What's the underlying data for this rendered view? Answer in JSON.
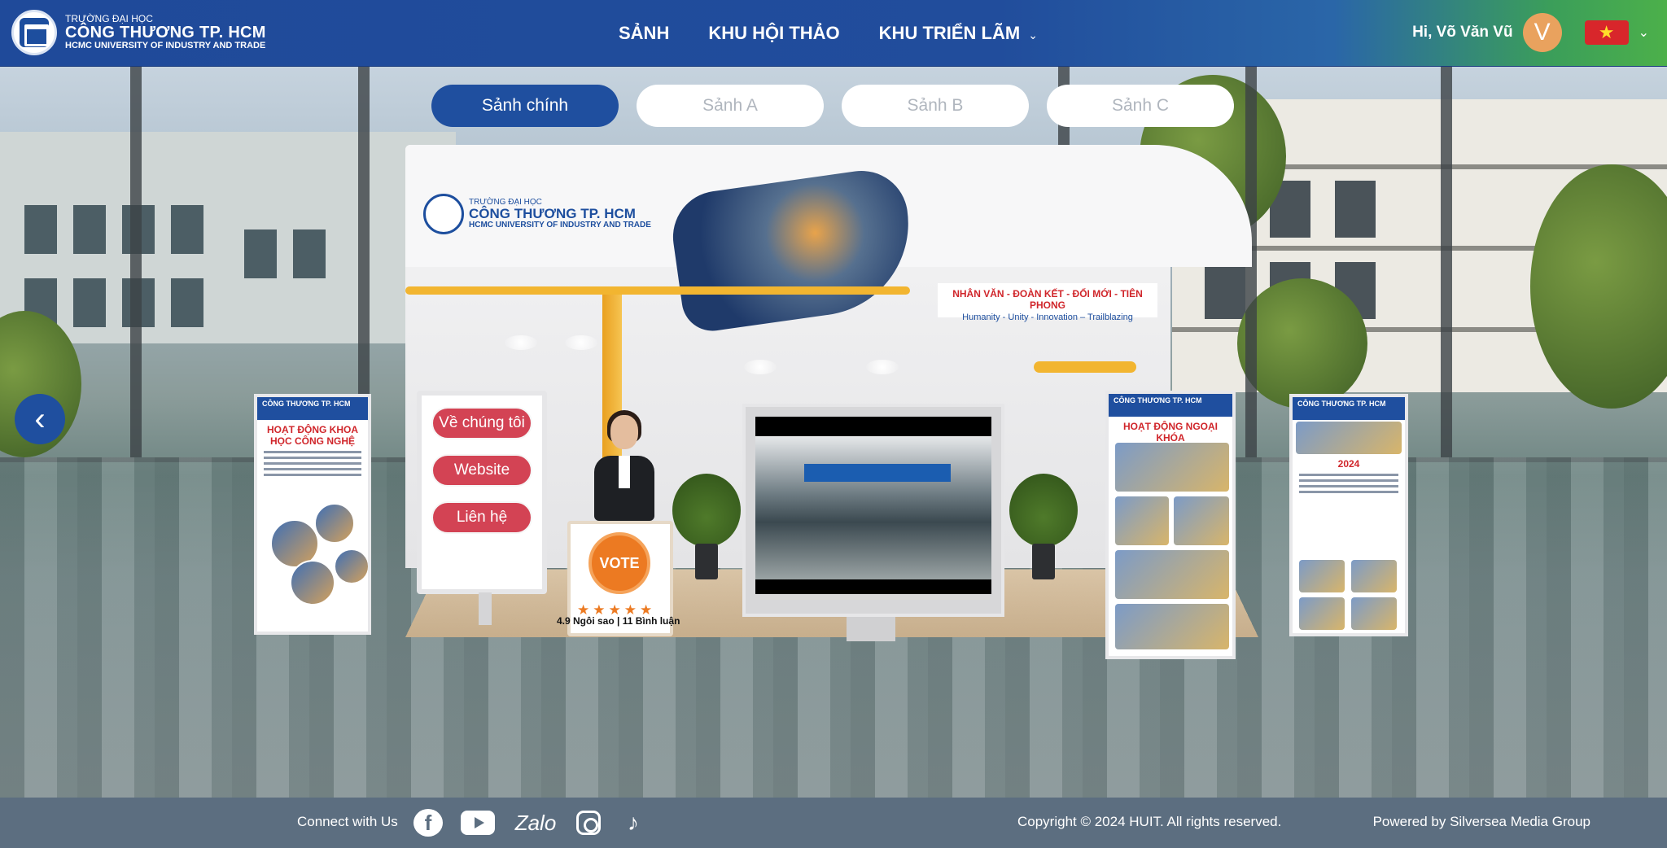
{
  "header": {
    "logo": {
      "line1": "TRƯỜNG ĐẠI HỌC",
      "line2": "CÔNG THƯƠNG TP. HCM",
      "line3": "HCMC UNIVERSITY OF INDUSTRY AND TRADE"
    },
    "nav": [
      {
        "label": "SẢNH"
      },
      {
        "label": "KHU HỘI THẢO"
      },
      {
        "label": "KHU TRIỂN LÃM",
        "has_dropdown": true
      }
    ],
    "user": {
      "greeting": "Hi, Võ Văn Vũ",
      "avatar_initial": "V",
      "avatar_color": "#e9a25e",
      "language_flag": "vietnam-flag-icon"
    }
  },
  "tabs": [
    {
      "label": "Sảnh chính",
      "active": true
    },
    {
      "label": "Sảnh A",
      "active": false
    },
    {
      "label": "Sảnh B",
      "active": false
    },
    {
      "label": "Sảnh C",
      "active": false
    }
  ],
  "booth": {
    "logo": {
      "line1": "TRƯỜNG ĐẠI HỌC",
      "line2": "CÔNG THƯƠNG TP. HCM",
      "line3": "HCMC UNIVERSITY OF INDUSTRY AND TRADE"
    },
    "slogan_vi": "NHÂN VĂN - ĐOÀN KẾT - ĐỔI MỚI - TIÊN PHONG",
    "slogan_en": "Humanity - Unity - Innovation – Trailblazing",
    "menu": [
      {
        "label": "Về chúng tôi"
      },
      {
        "label": "Website"
      },
      {
        "label": "Liên hệ"
      }
    ],
    "vote": {
      "badge": "VOTE",
      "stars": 5,
      "rating_text": "4.9 Ngôi sao | 11 Bình luận"
    },
    "poster_left": {
      "title": "HOẠT ĐỘNG KHOA HỌC CÔNG NGHỆ",
      "header": "CÔNG THƯƠNG TP. HCM"
    },
    "poster_mid": {
      "title": "HOẠT ĐỘNG NGOẠI KHÓA",
      "header": "CÔNG THƯƠNG TP. HCM"
    },
    "poster_right": {
      "title": "2024",
      "header": "CÔNG THƯƠNG TP. HCM"
    }
  },
  "footer": {
    "connect": "Connect with Us",
    "socials": [
      "facebook-icon",
      "youtube-icon",
      "zalo-icon",
      "instagram-icon",
      "tiktok-icon"
    ],
    "zalo_label": "Zalo",
    "copyright": "Copyright © 2024 HUIT. All rights reserved.",
    "powered": "Powered by Silversea Media Group"
  },
  "colors": {
    "brand_blue": "#1f4f9f",
    "menu_red": "#d34354",
    "vote_orange": "#ec7a22",
    "footer_bg": "#5c6e80"
  }
}
